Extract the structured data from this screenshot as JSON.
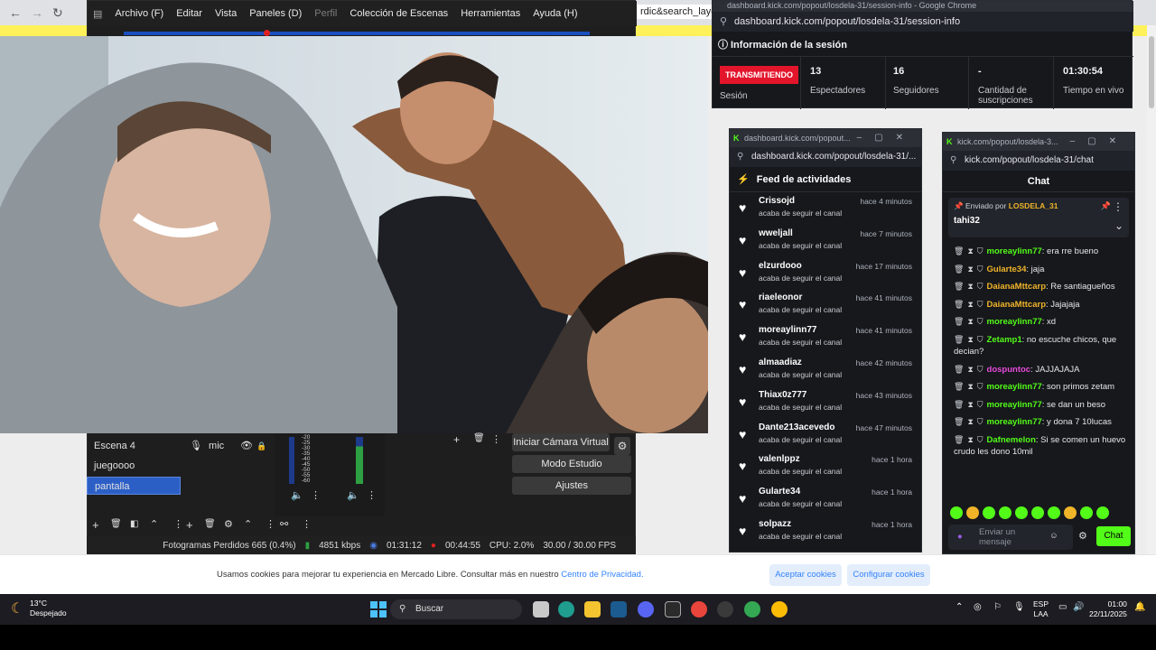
{
  "background_browser": {
    "url_fragment": "rdic&search_layout=",
    "cookie_banner": {
      "text": "Usamos cookies para mejorar tu experiencia en Mercado Libre. Consultar más en nuestro",
      "link": "Centro de Privacidad.",
      "accept": "Aceptar cookies",
      "configure": "Configurar cookies"
    }
  },
  "obs": {
    "menu": [
      "Archivo (F)",
      "Editar",
      "Vista",
      "Paneles (D)",
      "Perfil",
      "Colección de Escenas",
      "Herramientas",
      "Ayuda (H)"
    ],
    "scenes": [
      "Escena 4",
      "juegoooo",
      "pantalla"
    ],
    "selected_scene": "pantalla",
    "source": "mic",
    "meter_ticks": [
      "-20",
      "-25",
      "-30",
      "-35",
      "-40",
      "-45",
      "-50",
      "-55",
      "-60"
    ],
    "controls": [
      "Iniciar Cámara Virtual",
      "Modo Estudio",
      "Ajustes"
    ],
    "status": {
      "dropped": "Fotogramas Perdidos 665 (0.4%)",
      "kbps": "4851 kbps",
      "stream_time": "01:31:12",
      "rec_time": "00:44:55",
      "cpu": "CPU: 2.0%",
      "fps": "30.00 / 30.00 FPS"
    }
  },
  "session": {
    "window_title": "dashboard.kick.com/popout/losdela-31/session-info - Google Chrome",
    "url": "dashboard.kick.com/popout/losdela-31/session-info",
    "heading": "Información de la sesión",
    "live_badge": "TRANSMITIENDO",
    "session_label": "Sesión",
    "stats": [
      {
        "value": "13",
        "label": "Espectadores"
      },
      {
        "value": "16",
        "label": "Seguidores"
      },
      {
        "value": "-",
        "label": "Cantidad de suscripciones"
      },
      {
        "value": "01:30:54",
        "label": "Tiempo en vivo"
      }
    ]
  },
  "feed": {
    "window_title": "dashboard.kick.com/popout...",
    "url": "dashboard.kick.com/popout/losdela-31/...",
    "heading": "Feed de actividades",
    "action": "acaba de seguir el canal",
    "items": [
      {
        "name": "Crissojd",
        "time": "hace 4 minutos"
      },
      {
        "name": "wweljall",
        "time": "hace 7 minutos"
      },
      {
        "name": "elzurdooo",
        "time": "hace 17 minutos"
      },
      {
        "name": "riaeleonor",
        "time": "hace 41 minutos"
      },
      {
        "name": "moreaylinn77",
        "time": "hace 41 minutos"
      },
      {
        "name": "almaadiaz",
        "time": "hace 42 minutos"
      },
      {
        "name": "Thiax0z777",
        "time": "hace 43 minutos"
      },
      {
        "name": "Dante213acevedo",
        "time": "hace 47 minutos"
      },
      {
        "name": "valenlppz",
        "time": "hace 1 hora"
      },
      {
        "name": "Gularte34",
        "time": "hace 1 hora"
      },
      {
        "name": "solpazz",
        "time": "hace 1 hora"
      }
    ]
  },
  "chat": {
    "window_title": "kick.com/popout/losdela-3...",
    "url": "kick.com/popout/losdela-31/chat",
    "heading": "Chat",
    "pinned_by_label": "Enviado por",
    "pinned_by": "LOSDELA_31",
    "pinned_msg": "tahi32",
    "messages": [
      {
        "user": "moreaylinn77",
        "color": "#53fc18",
        "text": ": era rre bueno"
      },
      {
        "user": "Gularte34",
        "color": "#f0b429",
        "text": ": jaja"
      },
      {
        "user": "DaianaMttcarp",
        "color": "#f0b429",
        "text": ": Re santiagueños"
      },
      {
        "user": "DaianaMttcarp",
        "color": "#f0b429",
        "text": ": Jajajaja"
      },
      {
        "user": "moreaylinn77",
        "color": "#53fc18",
        "text": ": xd"
      },
      {
        "user": "Zetamp1",
        "color": "#53fc18",
        "text": ": no escuche chicos, que decian?"
      },
      {
        "user": "dospuntoc",
        "color": "#e64bd9",
        "text": ": JAJJAJAJA"
      },
      {
        "user": "moreaylinn77",
        "color": "#53fc18",
        "text": ": son primos zetam"
      },
      {
        "user": "moreaylinn77",
        "color": "#53fc18",
        "text": ": se dan un beso"
      },
      {
        "user": "moreaylinn77",
        "color": "#53fc18",
        "text": ": y dona 7 10lucas"
      },
      {
        "user": "Dafnemelon",
        "color": "#53fc18",
        "text": ": Si se comen un huevo crudo les dono 10mil"
      }
    ],
    "input_placeholder": "Enviar un mensaje",
    "send_label": "Chat"
  },
  "taskbar": {
    "weather_temp": "13°C",
    "weather_desc": "Despejado",
    "search": "Buscar",
    "lang1": "ESP",
    "lang2": "LAA",
    "time": "01:00",
    "date": "22/11/2025"
  }
}
